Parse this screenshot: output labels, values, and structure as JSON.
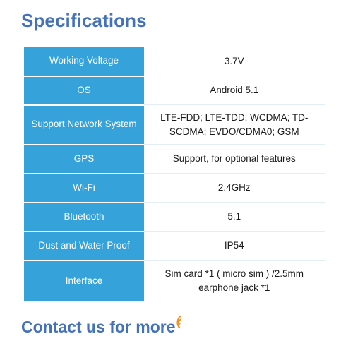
{
  "title": "Specifications",
  "table": {
    "rows": [
      {
        "label": "Working Voltage",
        "value": "3.7V"
      },
      {
        "label": "OS",
        "value": "Android 5.1"
      },
      {
        "label": "Support Network System",
        "value": "LTE-FDD; LTE-TDD; WCDMA; TD-SCDMA; EVDO/CDMA0; GSM"
      },
      {
        "label": "GPS",
        "value": "Support, for optional features"
      },
      {
        "label": "Wi-Fi",
        "value": "2.4GHz"
      },
      {
        "label": "Bluetooth",
        "value": "5.1"
      },
      {
        "label": "Dust and Water Proof",
        "value": "IP54"
      },
      {
        "label": "Interface",
        "value": "Sim card *1 ( micro sim ) /2.5mm earphone jack *1"
      }
    ]
  },
  "footer": {
    "text": "Contact us for more",
    "icon": "signal-waves-icon"
  },
  "colors": {
    "heading": "#4472b8",
    "label_cell_bg": "#35a3d9",
    "label_cell_text": "#ffffff",
    "value_cell_text": "#1a1a1a",
    "table_border": "#d8e6f2",
    "accent_icon": "#f29221"
  }
}
